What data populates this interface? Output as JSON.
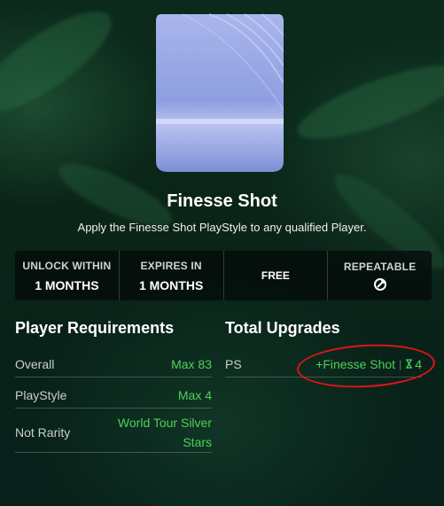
{
  "item": {
    "title": "Finesse Shot",
    "description": "Apply the Finesse Shot PlayStyle to any qualified Player."
  },
  "info": {
    "unlock_label": "UNLOCK WITHIN",
    "unlock_value": "1 MONTHS",
    "expires_label": "EXPIRES IN",
    "expires_value": "1 MONTHS",
    "cost_label": "FREE",
    "repeatable_label": "REPEATABLE",
    "repeatable_icon": "repeat-icon"
  },
  "requirements": {
    "title": "Player Requirements",
    "rows": [
      {
        "label": "Overall",
        "value": "Max 83"
      },
      {
        "label": "PlayStyle",
        "value": "Max 4"
      },
      {
        "label": "Not Rarity",
        "value": "World Tour Silver Stars"
      }
    ]
  },
  "upgrades": {
    "title": "Total Upgrades",
    "rows": [
      {
        "label": "PS",
        "value": "+Finesse Shot",
        "separator": "|",
        "count": "4"
      }
    ]
  },
  "colors": {
    "accent_green": "#4fd05a",
    "highlight_red": "#e0141a",
    "card_blue": "#8e9ee0"
  }
}
